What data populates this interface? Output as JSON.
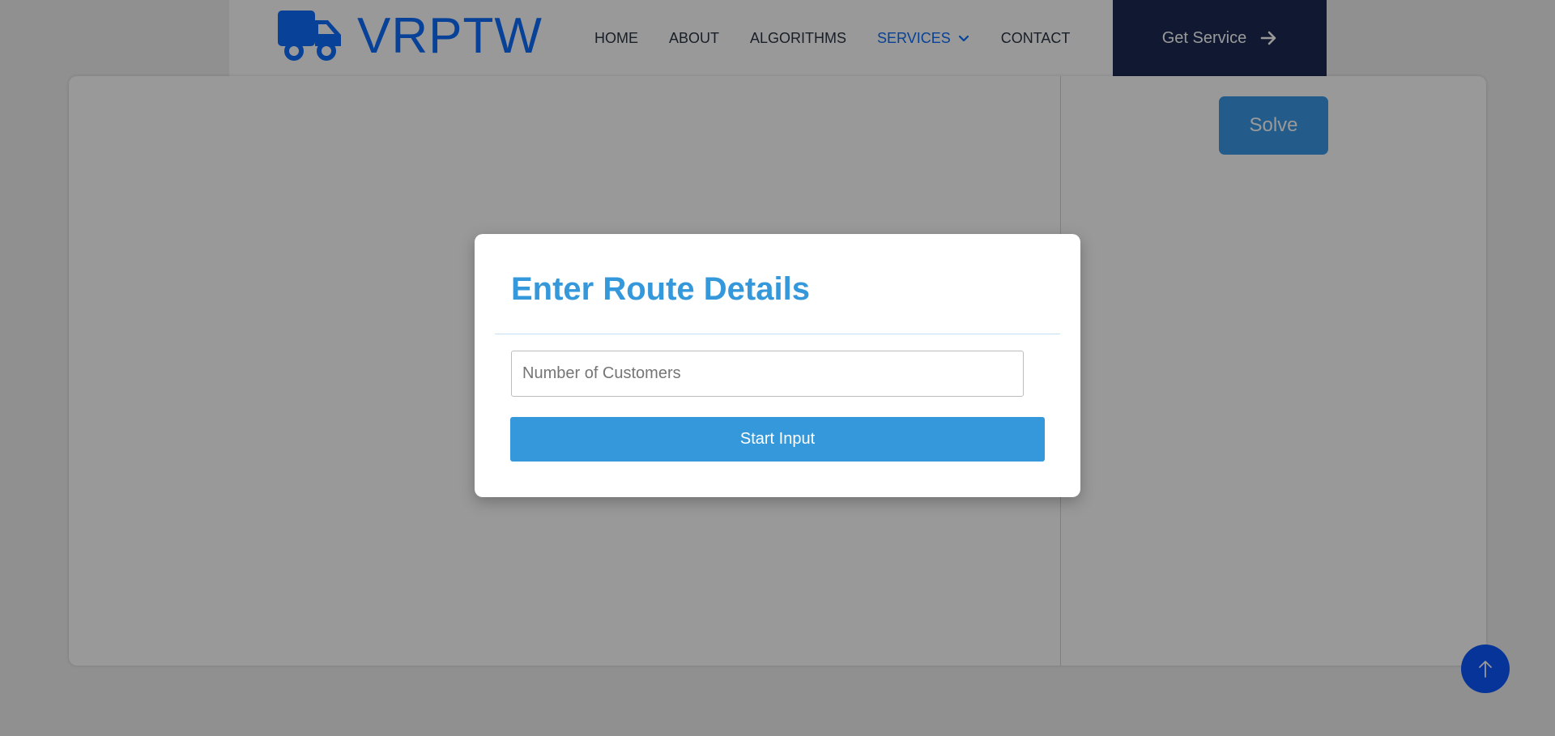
{
  "brand": {
    "name": "VRPTW",
    "icon": "truck-icon",
    "color": "#0d6efd"
  },
  "nav": {
    "items": [
      {
        "label": "HOME"
      },
      {
        "label": "ABOUT"
      },
      {
        "label": "ALGORITHMS"
      },
      {
        "label": "SERVICES",
        "active": true,
        "icon": "chevron-down-icon"
      },
      {
        "label": "CONTACT"
      }
    ],
    "cta": {
      "label": "Get Service",
      "icon": "arrow-right-icon",
      "background": "#1b2a52"
    }
  },
  "workspace": {
    "solve_label": "Solve",
    "solve_color": "#3b9ae8"
  },
  "modal": {
    "title": "Enter Route Details",
    "input": {
      "placeholder": "Number of Customers",
      "value": ""
    },
    "submit_label": "Start Input",
    "accent": "#3498db"
  },
  "scroll_top": {
    "icon": "arrow-up-icon",
    "color": "#0a58ff"
  }
}
